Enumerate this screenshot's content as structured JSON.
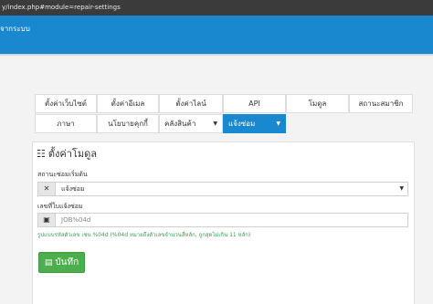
{
  "browser": {
    "url_fragment": "y/index.php#module=repair-settings"
  },
  "top_nav": {
    "logout_label": "จากระบบ"
  },
  "tabs_row1": [
    {
      "label": "ตั้งค่าเว็บไซต์"
    },
    {
      "label": "ตั้งค่าอีเมล"
    },
    {
      "label": "ตั้งค่าไลน์"
    },
    {
      "label": "API"
    },
    {
      "label": "โมดูล"
    },
    {
      "label": "สถานะสมาชิก"
    }
  ],
  "tabs_row2": [
    {
      "label": "ภาษา"
    },
    {
      "label": "นโยบายคุกกี้"
    },
    {
      "label": "คลังสินค้า",
      "dropdown": true
    },
    {
      "label": "แจ้งซ่อม",
      "dropdown": true,
      "active": true
    }
  ],
  "form": {
    "heading": "ตั้งค่าโมดูล",
    "status_label": "สถานะซ่อมเริ่มต้น",
    "status_value": "แจ้งซ่อม",
    "job_label": "เลขที่ใบแจ้งซ่อม",
    "job_placeholder": "JOB%04d",
    "help_text": "รูปแบบรหัสตัวเลข เช่น %04d (%04d หมายถึงตัวเลขจำนวนสี่หลัก, ถูกสุดไม่เกิน 11 หลัก)",
    "save_label": "บันทึก"
  },
  "colors": {
    "nav": "#1a88cf",
    "success": "#4cae4c",
    "help": "#3c9b55"
  },
  "icons": {
    "heading": "settings-icon",
    "status_addon": "tools-icon",
    "job_addon": "number-icon",
    "save": "save-icon"
  }
}
